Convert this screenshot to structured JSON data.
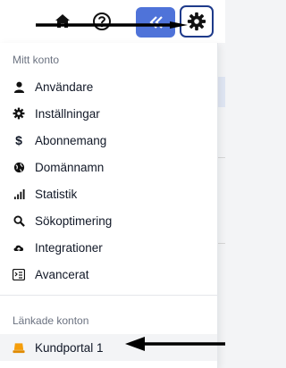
{
  "topbar": {
    "icons": [
      "home-icon",
      "help-icon",
      "collapse-icon",
      "gear-icon"
    ],
    "accent": "#4f73d9"
  },
  "menu": {
    "section1_title": "Mitt konto",
    "items": [
      {
        "label": "Användare",
        "icon": "user-icon"
      },
      {
        "label": "Inställningar",
        "icon": "settings-icon"
      },
      {
        "label": "Abonnemang",
        "icon": "dollar-icon"
      },
      {
        "label": "Domännamn",
        "icon": "globe-icon"
      },
      {
        "label": "Statistik",
        "icon": "stats-icon"
      },
      {
        "label": "Sökoptimering",
        "icon": "search-icon"
      },
      {
        "label": "Integrationer",
        "icon": "cloud-icon"
      },
      {
        "label": "Avancerat",
        "icon": "advanced-icon"
      }
    ],
    "section2_title": "Länkade konton",
    "linked": [
      {
        "label": "Kundportal 1",
        "icon": "portal-icon",
        "color": "#f59e0b"
      }
    ]
  }
}
